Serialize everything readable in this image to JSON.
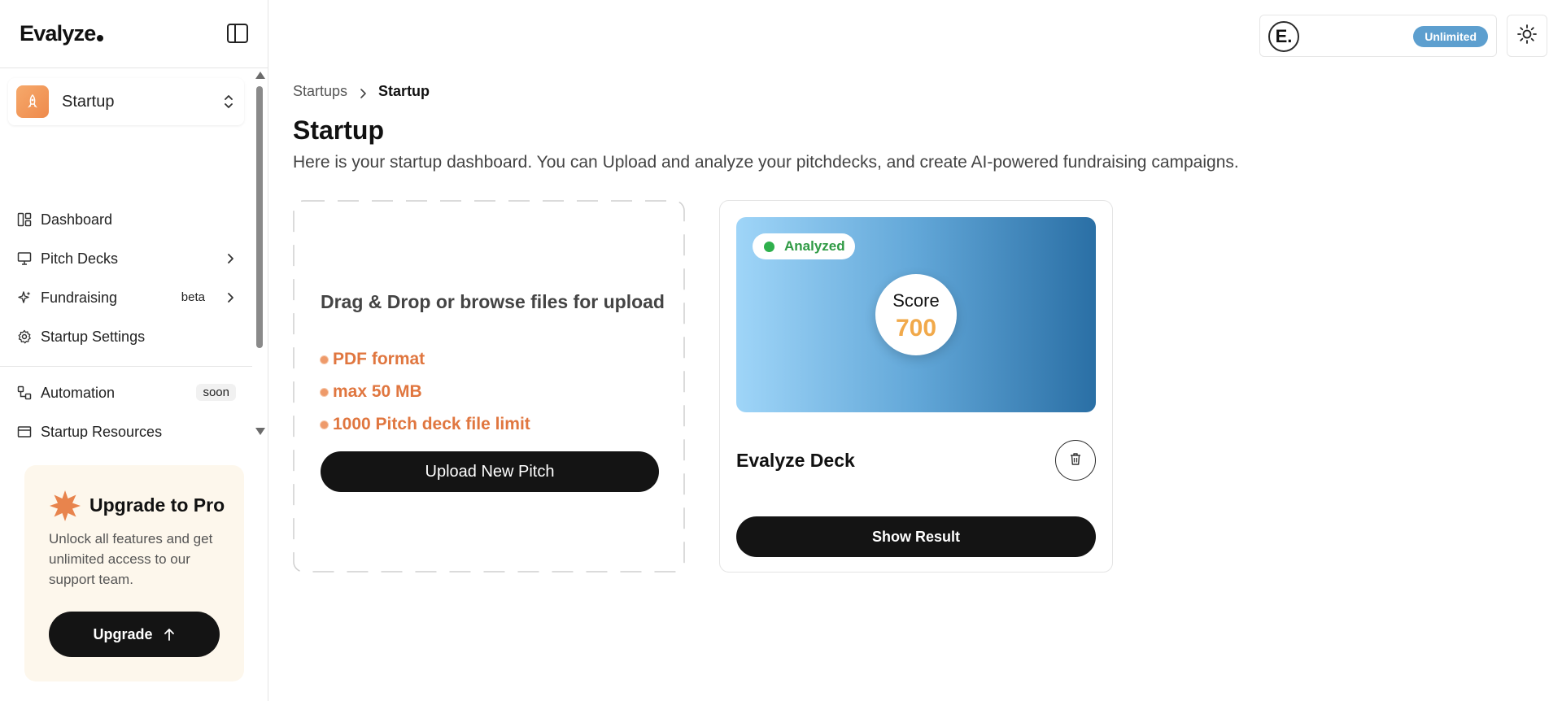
{
  "brand": {
    "logo_text": "Evalyze"
  },
  "sidebar": {
    "toggle_icon": "sidebar-panel-icon",
    "startup_switcher": {
      "name": "Startup",
      "icon": "rocket-icon"
    },
    "items": [
      {
        "label": "Dashboard",
        "icon": "dashboard-icon"
      },
      {
        "label": "Pitch Decks",
        "icon": "presentation-icon"
      },
      {
        "label": "Fundraising",
        "icon": "sparkles-icon",
        "badge": "beta"
      },
      {
        "label": "Startup Settings",
        "icon": "gear-icon"
      },
      {
        "label": "Automation",
        "icon": "workflow-icon",
        "badge": "soon"
      },
      {
        "label": "Startup Resources",
        "icon": "book-icon"
      }
    ],
    "upgrade": {
      "title": "Upgrade to Pro",
      "description": "Unlock all features and get unlimited access to our support team.",
      "button_label": "Upgrade"
    }
  },
  "topbar": {
    "account": {
      "avatar_letter": "E.",
      "plan_badge": "Unlimited"
    },
    "theme_icon": "sun-icon"
  },
  "breadcrumb": {
    "parent": "Startups",
    "current": "Startup"
  },
  "page": {
    "title": "Startup",
    "description": "Here is your startup dashboard. You can Upload and analyze your pitchdecks, and create AI-powered fundraising campaigns."
  },
  "upload": {
    "title": "Drag & Drop or browse files for upload",
    "requirements": [
      "PDF format",
      "max 50 MB",
      "1000 Pitch deck file limit"
    ],
    "button_label": "Upload New Pitch"
  },
  "deck": {
    "status": "Analyzed",
    "score_label": "Score",
    "score_value": "700",
    "name": "Evalyze Deck",
    "result_button": "Show Result"
  },
  "colors": {
    "accent_orange": "#e0763f",
    "status_green": "#2fb04c",
    "plan_badge_blue": "#5d9fcf",
    "score_gold": "#f1a94a",
    "button_dark": "#141414"
  }
}
